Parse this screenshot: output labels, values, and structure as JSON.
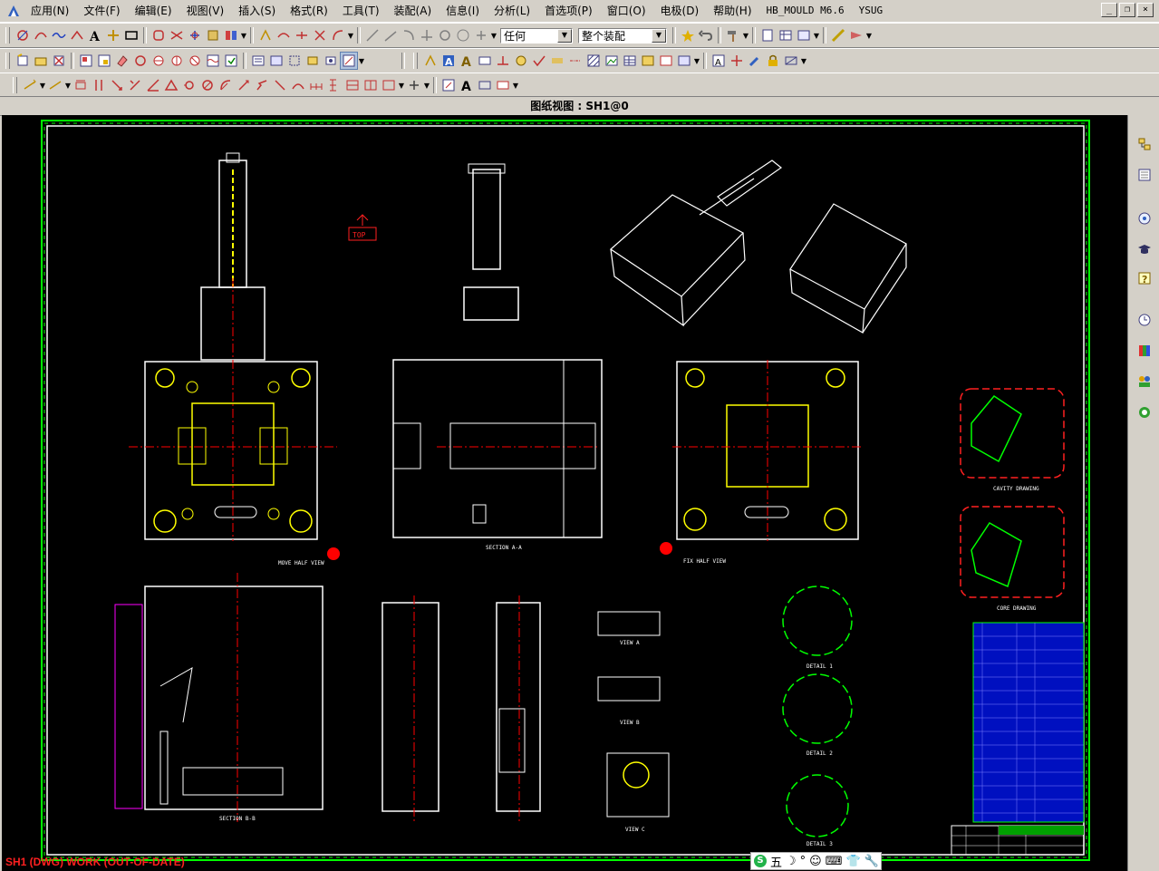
{
  "menu": {
    "items": [
      "应用(N)",
      "文件(F)",
      "编辑(E)",
      "视图(V)",
      "插入(S)",
      "格式(R)",
      "工具(T)",
      "装配(A)",
      "信息(I)",
      "分析(L)",
      "首选项(P)",
      "窗口(O)",
      "电极(D)",
      "帮助(H)",
      "HB_MOULD M6.6",
      "YSUG"
    ],
    "win_buttons": [
      "_",
      "❐",
      "×"
    ]
  },
  "toolbar1": {
    "filter_combo": "任何",
    "assembly_combo": "整个装配"
  },
  "view_title": "图纸视图 : SH1@0",
  "status": "SH1 (DWG) WORK (OUT-OF-DATE)",
  "ime": {
    "logo": "S",
    "label": "五",
    "icons": [
      "☽",
      "°",
      "☺",
      "⌨",
      "👕",
      "🔧"
    ]
  },
  "drawing": {
    "top_marker": "TOP",
    "view_labels": [
      "MOVE HALF VIEW",
      "FIX HALF VIEW",
      "SECTION A-A",
      "SECTION B-B",
      "VIEW A",
      "VIEW B",
      "VIEW C",
      "DETAIL 1",
      "DETAIL 2",
      "DETAIL 3",
      "CAVITY DRAWING",
      "CORE DRAWING"
    ]
  },
  "colors": {
    "accent_green": "#00ff00",
    "magenta": "#ff00ff",
    "yellow": "#ffff00",
    "red": "#ff0000",
    "title_block_blue": "#0000cc"
  }
}
